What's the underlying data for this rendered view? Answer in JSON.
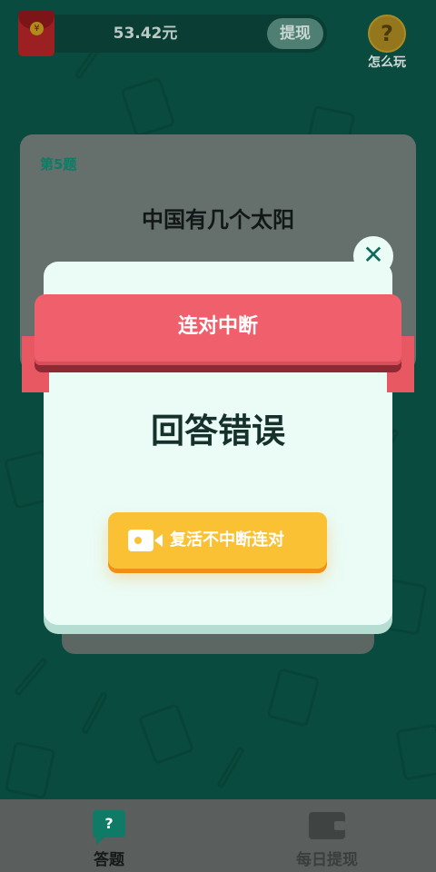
{
  "top_bar": {
    "balance": "53.42元",
    "withdraw_label": "提现",
    "help_icon": "?",
    "help_label": "怎么玩",
    "redpack_icon": "red-envelope-icon"
  },
  "question": {
    "number_label": "第5题",
    "text": "中国有几个太阳"
  },
  "modal": {
    "close_icon": "✕",
    "ribbon_title": "连对中断",
    "message": "回答错误",
    "revive_button_label": "复活不中断连对",
    "revive_icon": "video-camera-icon"
  },
  "bottom_nav": {
    "items": [
      {
        "label": "答题",
        "icon": "question-bubble-icon",
        "icon_glyph": "?",
        "active": true
      },
      {
        "label": "每日提现",
        "icon": "wallet-icon",
        "active": false
      }
    ]
  },
  "colors": {
    "background": "#0f7a65",
    "ribbon": "#f0606c",
    "revive_button": "#f9c133",
    "modal": "#ebfcf7"
  }
}
